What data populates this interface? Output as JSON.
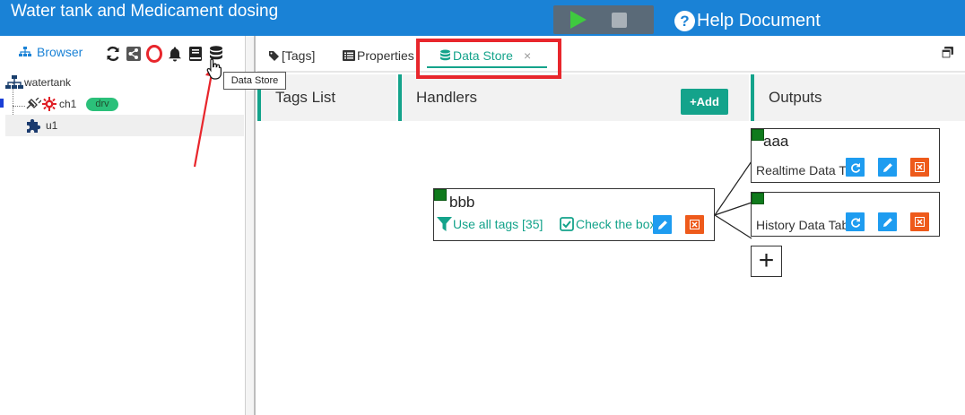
{
  "header": {
    "title": "Water tank and Medicament dosing",
    "help_label": "Help Document",
    "help_icon": "?"
  },
  "left": {
    "browser_label": "Browser",
    "tooltip": "Data Store",
    "tree": [
      {
        "label": "watertank"
      },
      {
        "label": "ch1",
        "badge": "drv"
      },
      {
        "label": "u1"
      }
    ]
  },
  "tabs": [
    {
      "label": "[Tags]"
    },
    {
      "label": "Properties"
    },
    {
      "label": "Data Store",
      "close": "×"
    }
  ],
  "columns": {
    "tags": "Tags List",
    "handlers": "Handlers",
    "outputs": "Outputs",
    "add_label": "+Add"
  },
  "handler": {
    "name": "bbb",
    "filter_label": "Use all tags [35]",
    "check_label": "Check the box"
  },
  "outputs": [
    {
      "name": "aaa",
      "type_label": "Realtime Data Table"
    },
    {
      "name": "",
      "type_label": "History Data Table"
    }
  ],
  "plus_label": "+",
  "colors": {
    "header": "#1a82d6",
    "accent": "#14a38b",
    "edit": "#1e9cf0",
    "delete": "#ee5a1b",
    "status_ok": "#0f7a1c",
    "highlight": "#e8262c"
  }
}
